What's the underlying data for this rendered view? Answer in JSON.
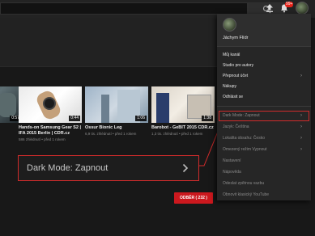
{
  "header": {
    "notification_count": "99+"
  },
  "videos": [
    {
      "title_line1": "",
      "title_line2": "",
      "meta": "",
      "duration": "0:57"
    },
    {
      "title_line1": "Hands-on Samsung Gear S2 |",
      "title_line2": "IFA 2015 Berlin | CDR.cz",
      "meta": "586 zhlédnutí • před 1 rokem",
      "duration": "0:44"
    },
    {
      "title_line1": "Ossur Bionic Leg",
      "title_line2": "",
      "meta": "6,9 tis. zhlédnutí • před 1 rokem",
      "duration": "1:06"
    },
    {
      "title_line1": "Barobot - GeBIT 2015 CDR.cz",
      "title_line2": "",
      "meta": "1,3 tis. zhlédnutí • před 1 rokem",
      "duration": "1:38"
    }
  ],
  "callout": {
    "label": "Dark Mode: Zapnout"
  },
  "subscribe_label": "ODBĚR ( 232 )",
  "menu": {
    "user_name": "Jáchym Flídr",
    "items": [
      {
        "label": "Můj kanál",
        "chevron": false,
        "dim": false
      },
      {
        "label": "Studio pro autory",
        "chevron": false,
        "dim": false
      },
      {
        "label": "Přepnout účet",
        "chevron": true,
        "dim": false
      },
      {
        "label": "Nákupy",
        "chevron": false,
        "dim": false
      },
      {
        "label": "Odhlásit se",
        "chevron": false,
        "dim": false
      },
      {
        "label": "Dark Mode: Zapnout",
        "chevron": true,
        "dim": true
      },
      {
        "label": "Jazyk: Čeština",
        "chevron": true,
        "dim": true
      },
      {
        "label": "Lokalita obsahu: Česko",
        "chevron": true,
        "dim": true
      },
      {
        "label": "Omezený režim Vypnout",
        "chevron": true,
        "dim": true
      },
      {
        "label": "Nastavení",
        "chevron": false,
        "dim": true
      },
      {
        "label": "Nápověda",
        "chevron": false,
        "dim": true
      },
      {
        "label": "Odeslat zpětnou vazbu",
        "chevron": false,
        "dim": true
      },
      {
        "label": "Obnovit klasický YouTube",
        "chevron": false,
        "dim": true
      }
    ]
  },
  "colors": {
    "accent_red": "#cc181e",
    "highlight_border": "#d02b2b"
  }
}
